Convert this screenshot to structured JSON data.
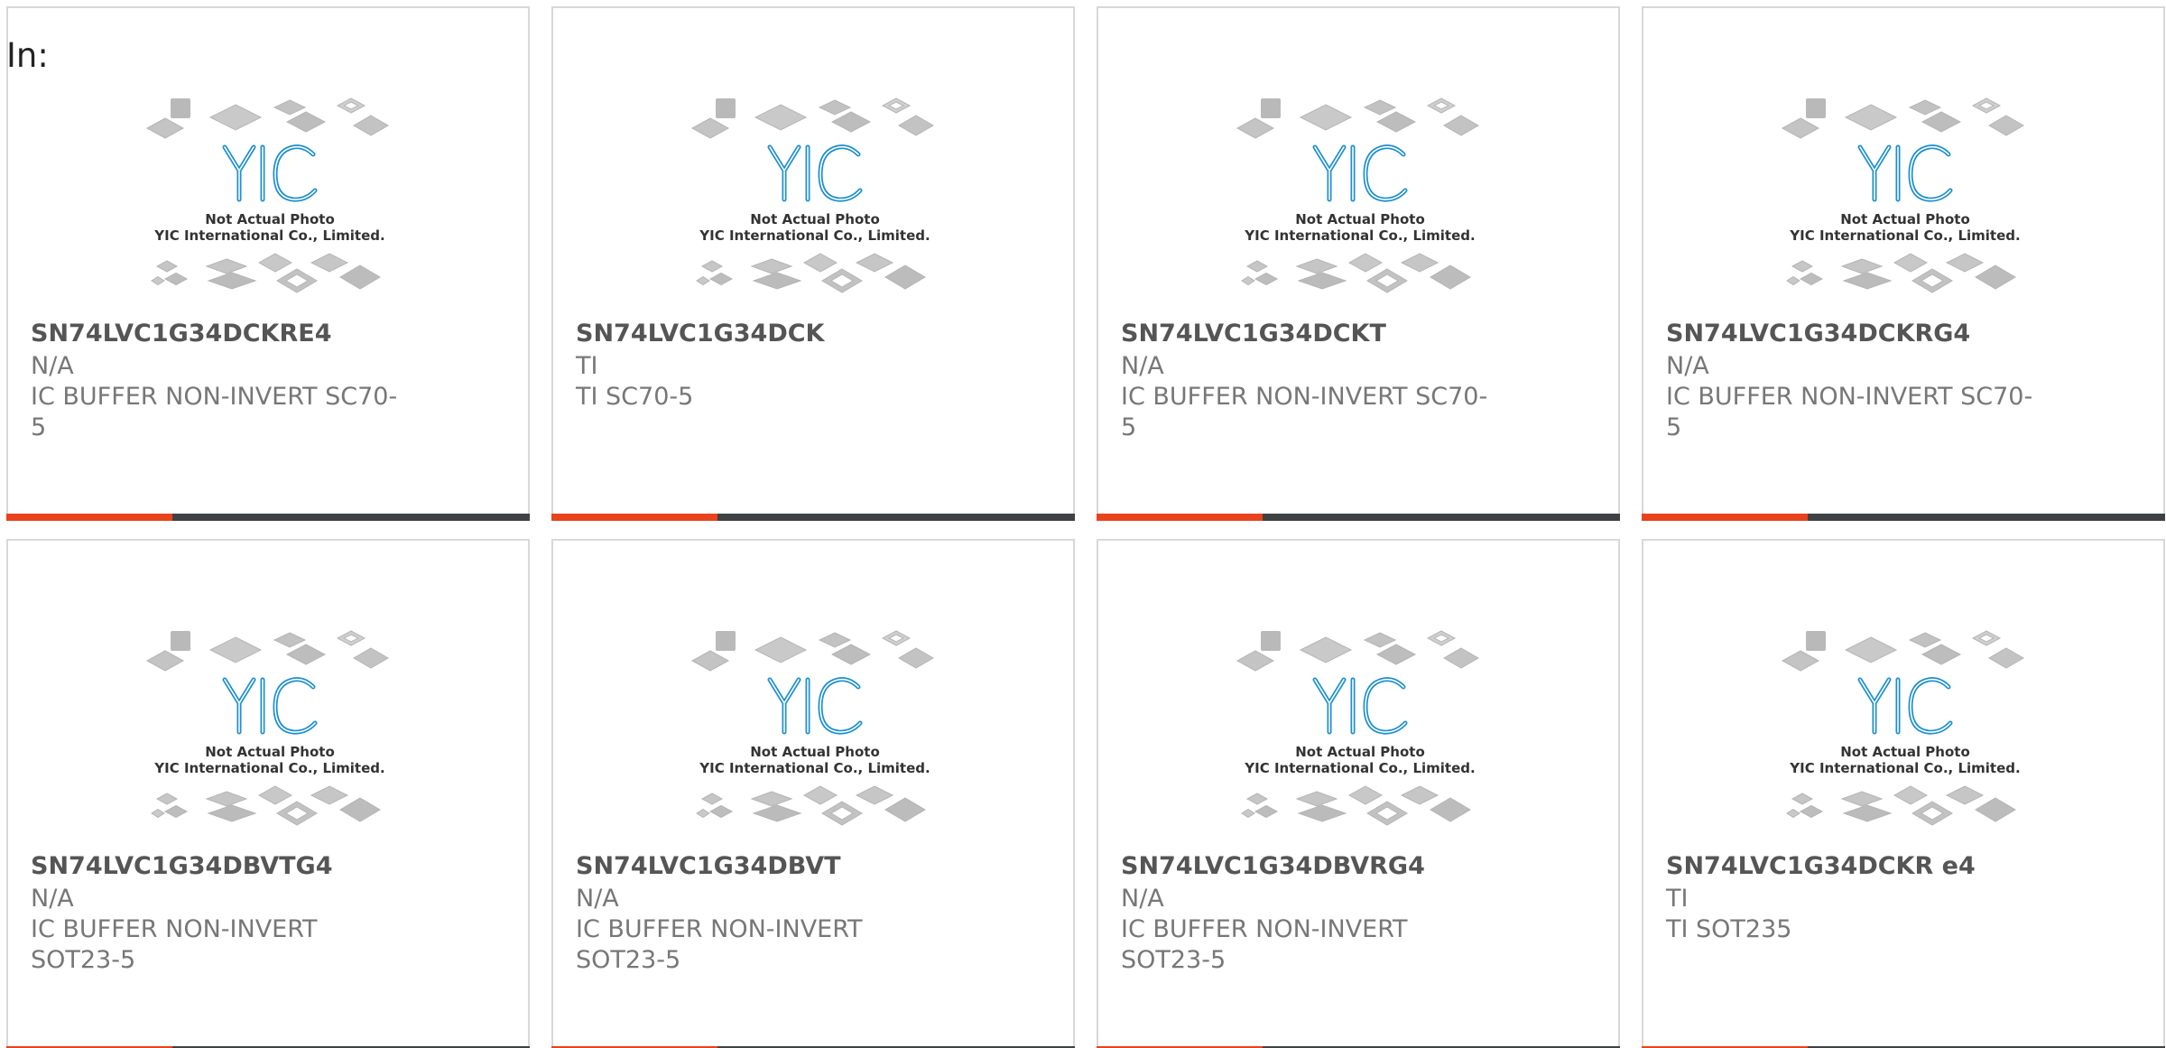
{
  "header": {
    "in_label": "In:"
  },
  "photo": {
    "caption_line1": "Not Actual Photo",
    "caption_line2": "YIC International Co., Limited.",
    "logo_text": "YIC",
    "logo_color": "#1c8fd0"
  },
  "colors": {
    "accent": "#e8431c",
    "bar": "#3f4245",
    "border": "#d8d8d8"
  },
  "products": [
    {
      "part": "SN74LVC1G34DCKRE4",
      "manufacturer": "N/A",
      "description": "IC BUFFER NON-INVERT SC70-5"
    },
    {
      "part": "SN74LVC1G34DCK",
      "manufacturer": "TI",
      "description": "TI SC70-5"
    },
    {
      "part": "SN74LVC1G34DCKT",
      "manufacturer": "N/A",
      "description": "IC BUFFER NON-INVERT SC70-5"
    },
    {
      "part": "SN74LVC1G34DCKRG4",
      "manufacturer": "N/A",
      "description": "IC BUFFER NON-INVERT SC70-5"
    },
    {
      "part": "SN74LVC1G34DBVTG4",
      "manufacturer": "N/A",
      "description": "IC BUFFER NON-INVERT SOT23-5"
    },
    {
      "part": "SN74LVC1G34DBVT",
      "manufacturer": "N/A",
      "description": "IC BUFFER NON-INVERT SOT23-5"
    },
    {
      "part": "SN74LVC1G34DBVRG4",
      "manufacturer": "N/A",
      "description": "IC BUFFER NON-INVERT SOT23-5"
    },
    {
      "part": "SN74LVC1G34DCKR e4",
      "manufacturer": "TI",
      "description": "TI SOT235"
    }
  ]
}
